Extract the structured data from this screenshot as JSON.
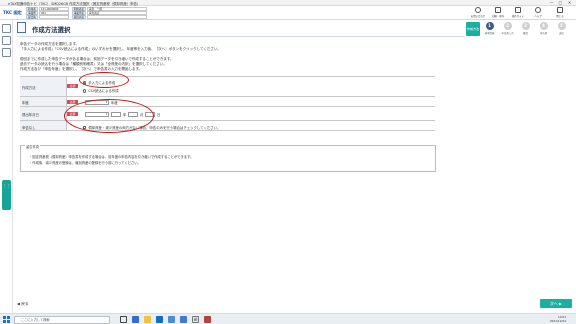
{
  "titlebar": {
    "title": "eTAX知識申告ナビ（TKC）  SMD26G8  作成方法選択（固定資産税（償却資産）申告）",
    "controls": [
      "—",
      "□",
      "✕"
    ]
  },
  "header": {
    "logo": "TKC 固定",
    "rows": [
      {
        "label": "利用者",
        "value": "121-0000000",
        "label2": "利用者名",
        "value2": "青色　一郎"
      },
      {
        "label": "事業所",
        "value": "001",
        "label2": "事業所名",
        "value2": "青色商店"
      },
      {
        "label": "提出先",
        "value": "",
        "label2": "提出先名",
        "value2": ""
      }
    ],
    "tools": [
      "お問い合わせ",
      "印刷・保存",
      "操作ガイド",
      "ヘルプ",
      "閉じる"
    ]
  },
  "page": {
    "title": "作成方法選択"
  },
  "steps": {
    "first": "作成方法",
    "items": [
      {
        "num": "1",
        "label": "基本情報"
      },
      {
        "num": "2",
        "label": "申告書入力"
      },
      {
        "num": "3",
        "label": "確認"
      },
      {
        "num": "4",
        "label": "申告書"
      },
      {
        "num": "5",
        "label": "送信"
      }
    ]
  },
  "instructions": [
    "申告データの作成方法を選択します。",
    "「手入力による作成」「CSV読込による作成」のいずれかを選択し、年度等を入力後、［次へ］ボタンをクリックしてください。",
    "前回までに作成した申告データがある場合は、前回データを引き継いで作成することができます。",
    "過去データの読込を行う場合は「種類別明細書」又は「全資産の内訳」を選択してください。",
    "作成方法及び「申告年度」を選択し、［次へ］で申告書の入力を開始します。"
  ],
  "form": {
    "method": {
      "label": "作成方法",
      "required": "必須",
      "options": [
        "手入力による作成",
        "CSV読込による作成"
      ],
      "selected": 0
    },
    "year": {
      "label": "年度",
      "required": "必須",
      "value": "",
      "suffix": "年度"
    },
    "date": {
      "label": "提出年月日",
      "required": "必須",
      "era": "",
      "year_unit": "年",
      "month_unit": "月",
      "day_unit": "日"
    },
    "nodata": {
      "label": "申告なし",
      "text": "償却資産・減少資産の両方がない場合、申告のみを行う場合はチェックしてください。"
    }
  },
  "notes": {
    "title": "留意事項",
    "lines": [
      "・固定資産税（償却資産）申告書を作成する場合は、前年度の申告内容を引き継いで作成することができます。",
      "・作成後、減少資産の登録は、増加資産の登録を行う前に行ってください。"
    ]
  },
  "footer": {
    "back": "戻る",
    "next": "次へ"
  },
  "taskbar": {
    "search_placeholder": "ここに入力して検索",
    "time": "10:01",
    "date": "2021/12/24"
  },
  "colors": {
    "accent": "#18b1a0",
    "required": "#d9484f",
    "annotation": "#c01818",
    "step_active": "#3b5f8a"
  }
}
